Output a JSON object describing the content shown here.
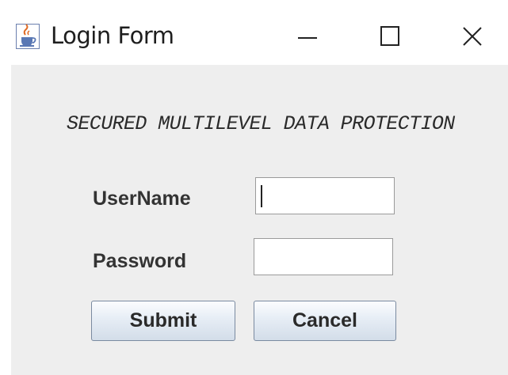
{
  "window": {
    "title": "Login Form",
    "icon": "java-cup-icon",
    "controls": {
      "minimize": "minimize-icon",
      "maximize": "maximize-icon",
      "close": "close-icon"
    }
  },
  "form": {
    "heading": "SECURED MULTILEVEL DATA PROTECTION",
    "username_label": "UserName",
    "username_value": "",
    "password_label": "Password",
    "password_value": "",
    "submit_label": "Submit",
    "cancel_label": "Cancel"
  },
  "colors": {
    "panel_background": "#eeeeee",
    "titlebar_background": "#ffffff",
    "button_border": "#7a8aa0"
  }
}
